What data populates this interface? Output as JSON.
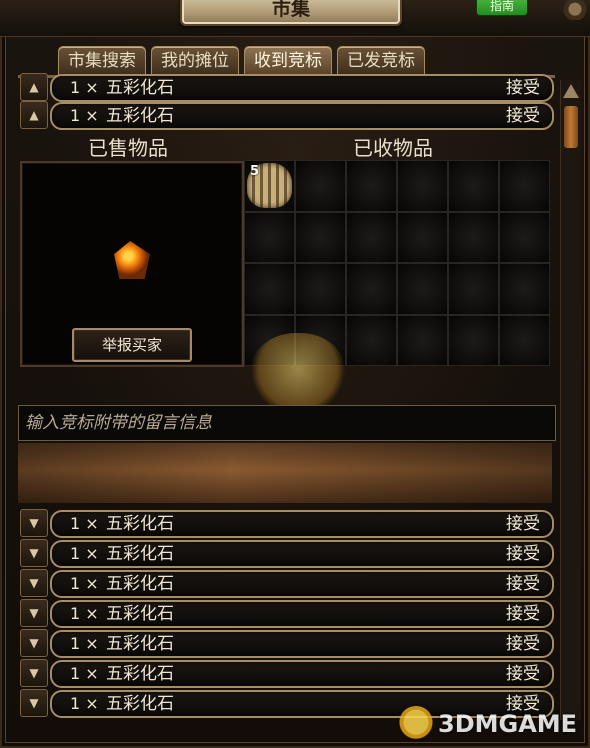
{
  "window": {
    "title": "市集",
    "guide_button": "指南"
  },
  "tabs": [
    {
      "label": "市集搜索",
      "active": false
    },
    {
      "label": "我的摊位",
      "active": false
    },
    {
      "label": "收到竞标",
      "active": true
    },
    {
      "label": "已发竞标",
      "active": false
    }
  ],
  "top_rows": [
    {
      "qty": "1 ×",
      "item": "五彩化石",
      "action": "接受"
    },
    {
      "qty": "1 ×",
      "item": "五彩化石",
      "action": "接受"
    }
  ],
  "detail": {
    "sold_heading": "已售物品",
    "received_heading": "已收物品",
    "report_button": "举报买家",
    "received_item_count": "5",
    "message_placeholder": "输入竞标附带的留言信息"
  },
  "bottom_rows": [
    {
      "qty": "1 ×",
      "item": "五彩化石",
      "action": "接受"
    },
    {
      "qty": "1 ×",
      "item": "五彩化石",
      "action": "接受"
    },
    {
      "qty": "1 ×",
      "item": "五彩化石",
      "action": "接受"
    },
    {
      "qty": "1 ×",
      "item": "五彩化石",
      "action": "接受"
    },
    {
      "qty": "1 ×",
      "item": "五彩化石",
      "action": "接受"
    },
    {
      "qty": "1 ×",
      "item": "五彩化石",
      "action": "接受"
    },
    {
      "qty": "1 ×",
      "item": "五彩化石",
      "action": "接受"
    }
  ],
  "watermark": {
    "text": "3DMGAME"
  },
  "colors": {
    "accent_border": "#a78d66",
    "guide_green": "#248a1f",
    "background": "#17120d"
  }
}
